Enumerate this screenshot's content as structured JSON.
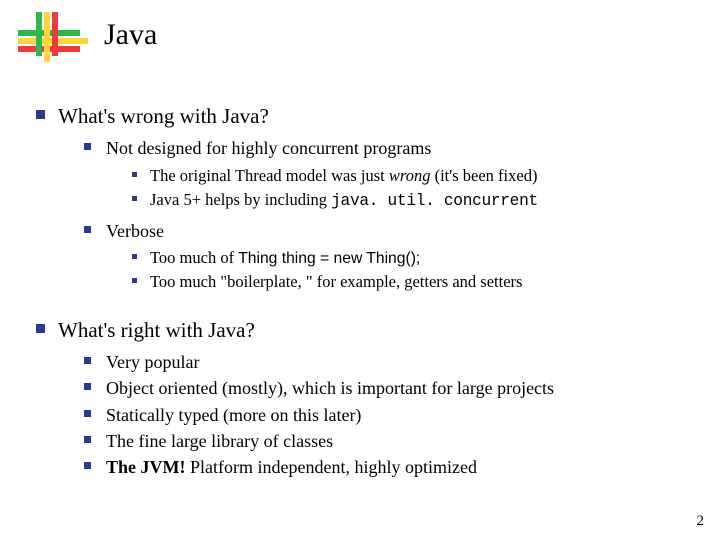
{
  "title": "Java",
  "page_number": "2",
  "bullets": {
    "q1": "What's wrong with Java?",
    "q1_a": "Not designed for highly concurrent programs",
    "q1_a_i_pre": "The original Thread model was just ",
    "q1_a_i_em": "wrong ",
    "q1_a_i_post": "(it's been fixed)",
    "q1_a_ii_pre": "Java 5+ helps by including ",
    "q1_a_ii_code": "java. util. concurrent",
    "q1_b": "Verbose",
    "q1_b_i_pre": "Too much of ",
    "q1_b_i_code": "Thing thing = new Thing();",
    "q1_b_ii": "Too much \"boilerplate, \" for example, getters and setters",
    "q2": "What's right with Java?",
    "q2_a": "Very popular",
    "q2_b": "Object oriented (mostly), which is important for large projects",
    "q2_c": "Statically typed (more on this later)",
    "q2_d": "The fine large library of classes",
    "q2_e_pre": "The JVM! ",
    "q2_e_post": "Platform independent, highly optimized"
  }
}
